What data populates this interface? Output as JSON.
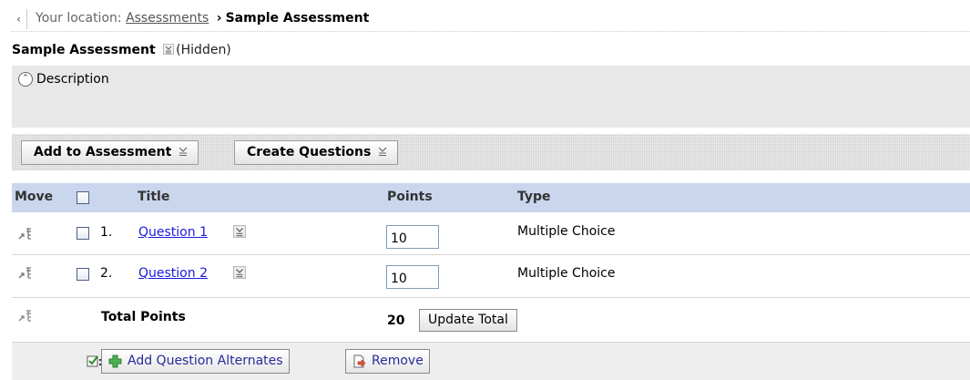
{
  "breadcrumb": {
    "back_label": "‹",
    "location_label": "Your location:",
    "parent": "Assessments",
    "separator": "›",
    "current": "Sample Assessment"
  },
  "header": {
    "title": "Sample Assessment",
    "status": "(Hidden)"
  },
  "description": {
    "toggle_glyph": "⌃",
    "label": "Description"
  },
  "toolbar": {
    "add_label": "Add to Assessment",
    "create_label": "Create Questions"
  },
  "table": {
    "columns": {
      "move": "Move",
      "title": "Title",
      "points": "Points",
      "type": "Type"
    },
    "rows": [
      {
        "num": "1.",
        "title": "Question 1",
        "points": "10",
        "type": "Multiple Choice"
      },
      {
        "num": "2.",
        "title": "Question 2",
        "points": "10",
        "type": "Multiple Choice"
      }
    ],
    "total": {
      "label": "Total Points",
      "value": "20",
      "update_label": "Update Total"
    }
  },
  "footer": {
    "add_alternates_label": "Add Question Alternates",
    "remove_label": "Remove"
  },
  "colors": {
    "header_bg": "#c9d6ed",
    "link": "#1a1adb",
    "panel_bg": "#e8e8e8"
  }
}
